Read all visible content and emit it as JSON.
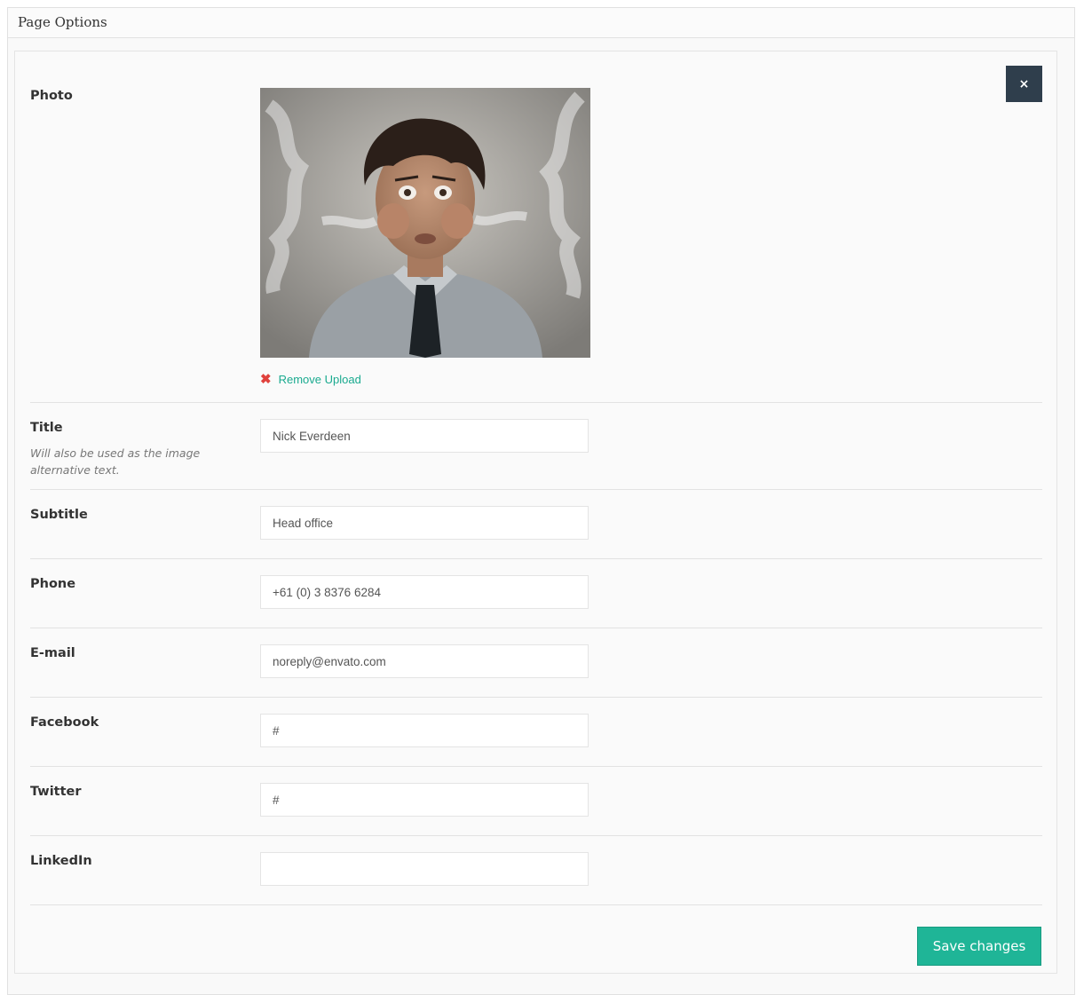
{
  "metabox": {
    "title": "Page Options"
  },
  "close_button": {
    "label": "×"
  },
  "photo": {
    "label": "Photo",
    "remove_label": "Remove Upload",
    "remove_icon": "close-x-icon"
  },
  "fields": {
    "title": {
      "label": "Title",
      "description": "Will also be used as the image alternative text.",
      "value": "Nick Everdeen"
    },
    "subtitle": {
      "label": "Subtitle",
      "value": "Head office"
    },
    "phone": {
      "label": "Phone",
      "value": "+61 (0) 3 8376 6284"
    },
    "email": {
      "label": "E-mail",
      "value": "noreply@envato.com"
    },
    "facebook": {
      "label": "Facebook",
      "value": "#"
    },
    "twitter": {
      "label": "Twitter",
      "value": "#"
    },
    "linkedin": {
      "label": "LinkedIn",
      "value": ""
    }
  },
  "save_button": {
    "label": "Save changes"
  },
  "colors": {
    "accent": "#1fb597",
    "close_button_bg": "#2f3e4c",
    "remove_icon": "#e0413c",
    "link": "#1aaa8f"
  }
}
